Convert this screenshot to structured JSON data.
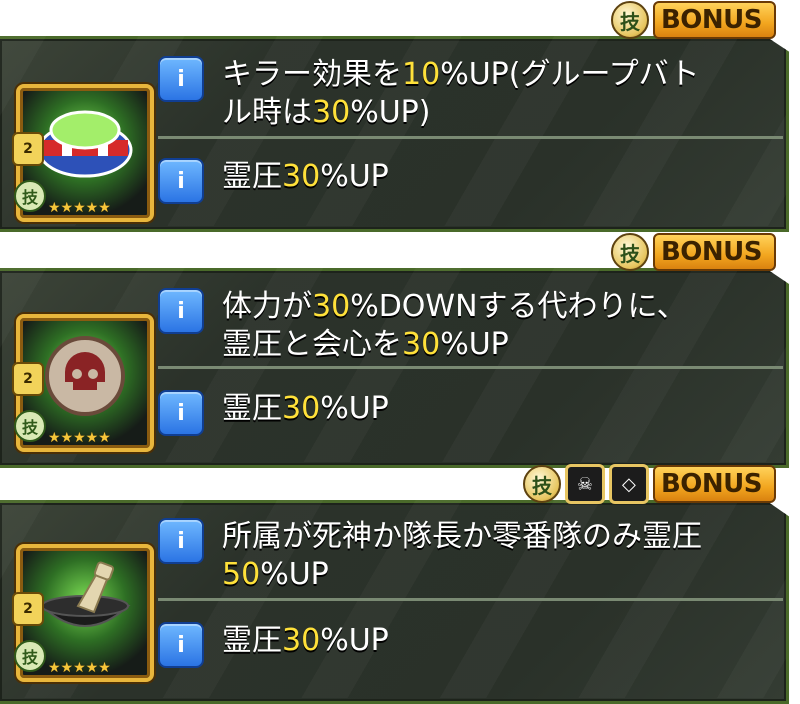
{
  "cards": [
    {
      "bonus_label": "BONUS",
      "badges": [
        "技"
      ],
      "item_name": "headband-with-green-gem",
      "lock_level": "2",
      "rank_badge": "技",
      "stars": "★★★★★",
      "ability_parts": [
        "キラー効果を",
        "10",
        "%UP(グループバト",
        "ル時は",
        "30",
        "%UP)"
      ],
      "stat_parts": [
        "霊圧",
        "30",
        "%UP"
      ]
    },
    {
      "bonus_label": "BONUS",
      "badges": [
        "技"
      ],
      "item_name": "skull-emblem",
      "lock_level": "2",
      "rank_badge": "技",
      "stars": "★★★★★",
      "ability_parts": [
        "体力が",
        "30",
        "%DOWNする代わりに、",
        "霊圧と会心を",
        "30",
        "%UP"
      ],
      "stat_parts": [
        "霊圧",
        "30",
        "%UP"
      ]
    },
    {
      "bonus_label": "BONUS",
      "badges": [
        "技",
        "skull-square-badge",
        "diamond-square-badge"
      ],
      "item_name": "tea-bowl-and-whisk",
      "lock_level": "2",
      "rank_badge": "技",
      "stars": "★★★★★",
      "ability_parts": [
        "所属が死神か隊長か零番隊のみ霊圧",
        "50",
        "%UP"
      ],
      "stat_parts": [
        "霊圧",
        "30",
        "%UP"
      ]
    }
  ],
  "colors": {
    "highlight": "#ffe13a",
    "frame": "#e8b63c",
    "info": "#2b74e4"
  }
}
